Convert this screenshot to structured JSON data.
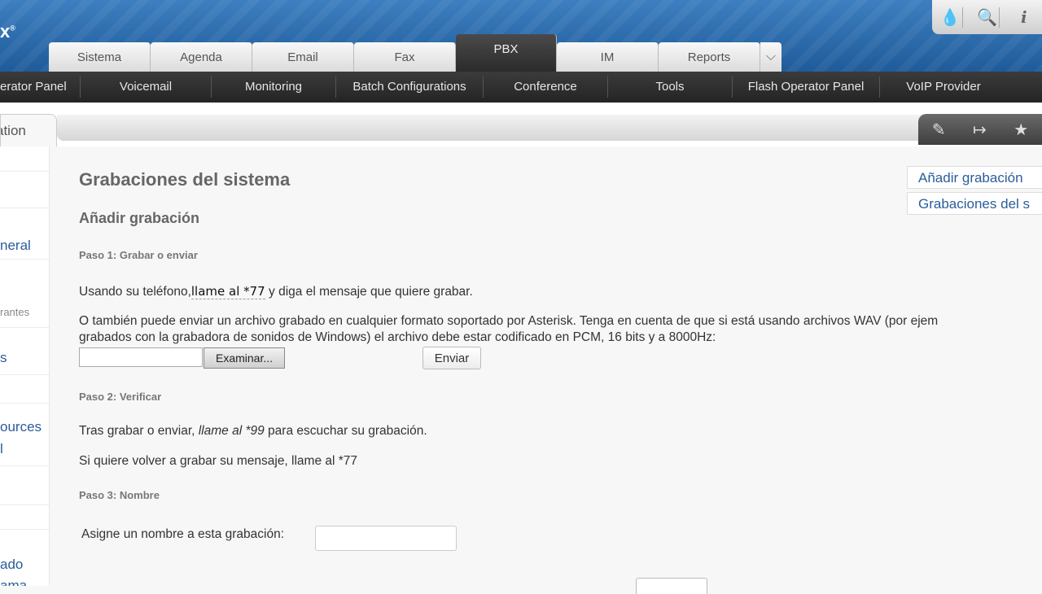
{
  "header": {
    "logo_fragment": "x",
    "logo_mark": "®",
    "tools": [
      {
        "icon": "drop-icon",
        "glyph": "💧"
      },
      {
        "icon": "search-icon",
        "glyph": "🔍"
      },
      {
        "icon": "info-icon",
        "glyph": "i"
      }
    ]
  },
  "tabs": [
    "Sistema",
    "Agenda",
    "Email",
    "Fax",
    "PBX",
    "IM",
    "Reports"
  ],
  "active_tab": "PBX",
  "subnav": [
    "erator Panel",
    "Voicemail",
    "Monitoring",
    "Batch Configurations",
    "Conference",
    "Tools",
    "Flash Operator Panel",
    "VoIP Provider"
  ],
  "breadcrumb_tab": "ation",
  "strip_tools": [
    "edit-icon",
    "logout-icon",
    "star-icon"
  ],
  "sidebar": {
    "items": [
      "neral",
      "rantes",
      "s",
      "ources",
      "l",
      "ado",
      "ama"
    ]
  },
  "main": {
    "title": "Grabaciones del sistema",
    "subtitle": "Añadir grabación",
    "step1": "Paso 1: Grabar o enviar",
    "step1_text_a": "Usando su teléfono,",
    "step1_text_hl": "llame al *77",
    "step1_text_b": " y diga el mensaje que quiere grabar.",
    "upload_line1": "O también puede enviar un archivo grabado en cualquier formato soportado por Asterisk. Tenga en cuenta de que si está usando archivos WAV (por ejem",
    "upload_line2": "grabados con la grabadora de sonidos de Windows) el archivo debe estar codificado en PCM, 16 bits y a 8000Hz:",
    "browse_label": "Examinar...",
    "send_label": "Enviar",
    "step2": "Paso 2: Verificar",
    "step2_text_a": "Tras grabar o enviar, ",
    "step2_text_em": "llame al *99",
    "step2_text_b": " para escuchar su grabación.",
    "step2_text2": "Si quiere volver a grabar su mensaje, llame al *77",
    "step3": "Paso 3: Nombre",
    "name_label": "Asigne un nombre a esta grabación:"
  },
  "right_links": [
    "Añadir grabación",
    "Grabaciones del s"
  ]
}
